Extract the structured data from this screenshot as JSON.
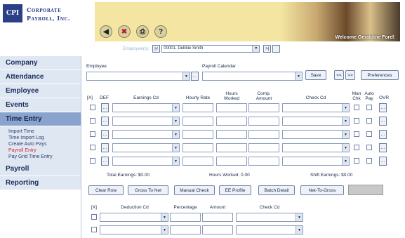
{
  "header": {
    "logo_abbrev": "CPI",
    "logo_line1": "Corporate",
    "logo_line2": "Payroll, Inc.",
    "welcome": "Welcome Geraldine Ford!",
    "icons": [
      "back-icon",
      "delete-icon",
      "print-icon",
      "help-icon"
    ],
    "icon_glyphs": [
      "◀",
      "✖",
      "⎙",
      "?"
    ]
  },
  "empnav": {
    "label": "Employee(s):",
    "first_btn": "|<",
    "selected": "00001, Debbie Smith",
    "next_btn": ">|"
  },
  "sidebar": {
    "items": [
      {
        "label": "Company"
      },
      {
        "label": "Attendance"
      },
      {
        "label": "Employee"
      },
      {
        "label": "Events"
      },
      {
        "label": "Time Entry"
      }
    ],
    "sub_items": [
      {
        "label": "Import Time"
      },
      {
        "label": "Time Import Log"
      },
      {
        "label": "Create Auto Pays"
      },
      {
        "label": "Payroll Entry"
      },
      {
        "label": "Pay Grid Time Entry"
      }
    ],
    "bottom_items": [
      {
        "label": "Payroll"
      },
      {
        "label": "Reporting"
      }
    ]
  },
  "form": {
    "employee_label": "Employee",
    "calendar_label": "Payroll Calendar",
    "save": "Save",
    "prev": "<<",
    "next": ">>",
    "preferences": "Preferences"
  },
  "earnings": {
    "headers": {
      "del": "[X]",
      "def": "DEF",
      "earnings_cd": "Earnings Cd",
      "hourly_rate": "Hourly Rate",
      "hours_worked": "Hours Worked",
      "comp_amount": "Comp. Amount",
      "check_cd": "Check Cd",
      "man_chk": "Man Chk",
      "auto_pay": "Auto Pay",
      "ovr": "OVR"
    },
    "row_count": 5,
    "dots": "...",
    "total_earnings": "Total Earnings: $0.00",
    "hours_worked": "Hours Worked: 0.00",
    "shift_earnings": "Shift Earnings: $0.00"
  },
  "actions": {
    "clear_row": "Clear Row",
    "gross_to_net": "Gross To Net",
    "manual_check": "Manual Check",
    "ee_profile": "EE Profile",
    "batch_detail": "Batch Detail",
    "net_to_gross": "Net-To-Gross"
  },
  "deductions": {
    "headers": {
      "del": "[X]",
      "deduction_cd": "Deduction Cd",
      "percentage": "Percentage",
      "amount": "Amount",
      "check_cd": "Check Cd"
    },
    "row_count": 2
  }
}
